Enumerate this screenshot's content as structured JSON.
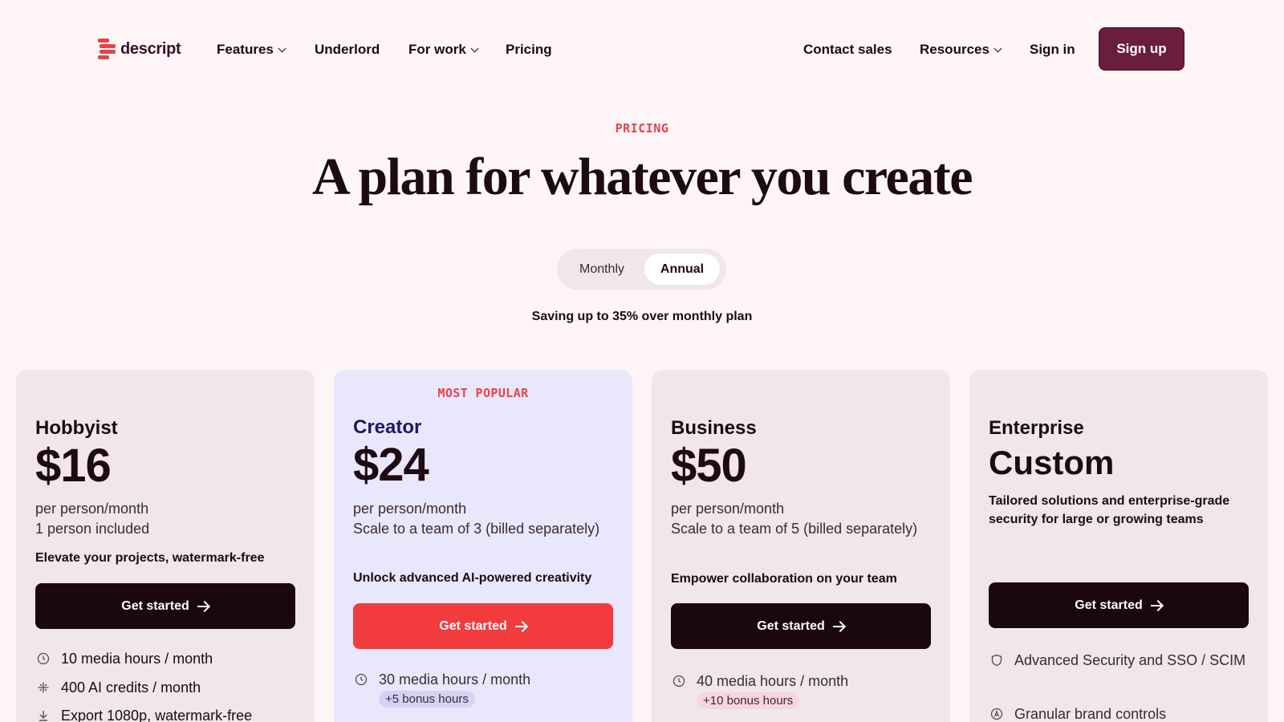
{
  "nav": {
    "logo_text": "descript",
    "items": [
      {
        "label": "Features",
        "has_dropdown": true
      },
      {
        "label": "Underlord",
        "has_dropdown": false
      },
      {
        "label": "For work",
        "has_dropdown": true
      },
      {
        "label": "Pricing",
        "has_dropdown": false
      }
    ],
    "right": {
      "contact_sales": "Contact sales",
      "resources": "Resources",
      "sign_in": "Sign in",
      "sign_up": "Sign up"
    }
  },
  "hero": {
    "eyebrow": "PRICING",
    "headline": "A plan for whatever you create",
    "billing_toggle": {
      "monthly": "Monthly",
      "annual": "Annual",
      "selected": "Annual"
    },
    "saving_note": "Saving up to 35% over monthly plan"
  },
  "plans": [
    {
      "name": "Hobbyist",
      "price": "$16",
      "unit": "per person/month",
      "team": "1 person included",
      "tagline": "Elevate your projects, watermark-free",
      "cta": "Get started",
      "features": [
        {
          "icon": "clock-icon",
          "text": "10 media hours / month"
        },
        {
          "icon": "sparkle-icon",
          "text": "400 AI credits / month"
        },
        {
          "icon": "download-icon",
          "text": "Export 1080p, watermark-free"
        }
      ]
    },
    {
      "badge": "MOST POPULAR",
      "name": "Creator",
      "price": "$24",
      "unit": "per person/month",
      "team": "Scale to a team of 3 (billed separately)",
      "tagline": "Unlock advanced AI-powered creativity",
      "cta": "Get started",
      "features": [
        {
          "icon": "clock-icon",
          "text": "30 media hours / month",
          "bonus": "+5 bonus hours"
        }
      ]
    },
    {
      "name": "Business",
      "price": "$50",
      "unit": "per person/month",
      "team": "Scale to a team of 5 (billed separately)",
      "tagline": "Empower collaboration on your team",
      "cta": "Get started",
      "features": [
        {
          "icon": "clock-icon",
          "text": "40 media hours / month",
          "bonus": "+10 bonus hours"
        }
      ]
    },
    {
      "name": "Enterprise",
      "price": "Custom",
      "tagline": "Tailored solutions and enterprise-grade security for large or growing teams",
      "cta": "Get started",
      "features": [
        {
          "icon": "shield-icon",
          "text": "Advanced Security and SSO / SCIM"
        },
        {
          "icon": "brand-icon",
          "text": "Granular brand controls"
        }
      ]
    }
  ],
  "colors": {
    "background": "#fdf5f6",
    "accent_red": "#e8424a",
    "signup_button": "#6b1d3e",
    "creator_card": "#e9e7fb",
    "card": "#f1e6e9",
    "dark_button": "#1a0710",
    "creator_button": "#f23b3d"
  }
}
